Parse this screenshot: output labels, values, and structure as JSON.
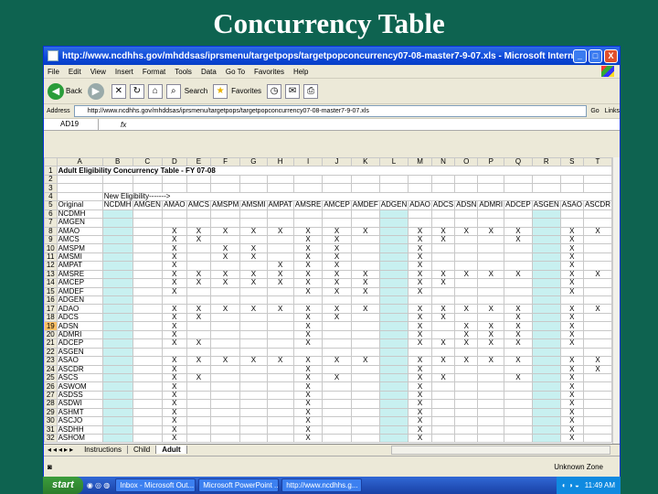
{
  "slide": {
    "title": "Concurrency Table"
  },
  "window": {
    "title": "http://www.ncdhhs.gov/mhddsas/iprsmenu/targetpops/targetpopconcurrency07-08-master7-9-07.xls - Microsoft Internet Explorer",
    "controls": {
      "min": "_",
      "max": "□",
      "close": "X"
    }
  },
  "menu": [
    "File",
    "Edit",
    "View",
    "Insert",
    "Format",
    "Tools",
    "Data",
    "Go To",
    "Favorites",
    "Help"
  ],
  "toolbar": {
    "back": "Back",
    "search": "Search",
    "favorites": "Favorites"
  },
  "address": {
    "label": "Address",
    "url": "http://www.ncdhhs.gov/mhddsas/iprsmenu/targetpops/targetpopconcurrency07-08-master7-9-07.xls",
    "go": "Go",
    "links": "Links"
  },
  "formula": {
    "namebox": "AD19",
    "fx": "fx"
  },
  "sheet": {
    "columns": [
      "A",
      "B",
      "C",
      "D",
      "E",
      "F",
      "G",
      "H",
      "I",
      "J",
      "K",
      "L",
      "M",
      "N",
      "O",
      "P",
      "Q",
      "R",
      "S",
      "T"
    ],
    "title_cell": "Adult Eligibility Concurrency Table - FY 07-08",
    "new_eligibility": "New Eligibility------->",
    "header_row": [
      "Original",
      "NCDMH",
      "AMGEN",
      "AMAO",
      "AMCS",
      "AMSPM",
      "AMSMI",
      "AMPAT",
      "AMSRE",
      "AMCEP",
      "AMDEF",
      "ADGEN",
      "ADAO",
      "ADCS",
      "ADSN",
      "ADMRI",
      "ADCEP",
      "ASGEN",
      "ASAO",
      "ASCDR"
    ],
    "rows": [
      [
        "NCDMH",
        "",
        "",
        "",
        "",
        "",
        "",
        "",
        "",
        "",
        "",
        "",
        "",
        "",
        "",
        "",
        "",
        "",
        "",
        ""
      ],
      [
        "AMGEN",
        "",
        "",
        "",
        "",
        "",
        "",
        "",
        "",
        "",
        "",
        "",
        "",
        "",
        "",
        "",
        "",
        "",
        "",
        ""
      ],
      [
        "AMAO",
        "",
        "",
        "X",
        "X",
        "X",
        "X",
        "X",
        "X",
        "X",
        "X",
        "",
        "X",
        "X",
        "X",
        "X",
        "X",
        "",
        "X",
        "X"
      ],
      [
        "AMCS",
        "",
        "",
        "X",
        "X",
        "",
        "",
        "",
        "X",
        "X",
        "",
        "",
        "X",
        "X",
        "",
        "",
        "X",
        "",
        "X",
        ""
      ],
      [
        "AMSPM",
        "",
        "",
        "X",
        "",
        "X",
        "X",
        "",
        "X",
        "X",
        "",
        "",
        "X",
        "",
        "",
        "",
        "",
        "",
        "X",
        ""
      ],
      [
        "AMSMI",
        "",
        "",
        "X",
        "",
        "X",
        "X",
        "",
        "X",
        "X",
        "",
        "",
        "X",
        "",
        "",
        "",
        "",
        "",
        "X",
        ""
      ],
      [
        "AMPAT",
        "",
        "",
        "X",
        "",
        "",
        "",
        "X",
        "X",
        "X",
        "",
        "",
        "X",
        "",
        "",
        "",
        "",
        "",
        "X",
        ""
      ],
      [
        "AMSRE",
        "",
        "",
        "X",
        "X",
        "X",
        "X",
        "X",
        "X",
        "X",
        "X",
        "",
        "X",
        "X",
        "X",
        "X",
        "X",
        "",
        "X",
        "X"
      ],
      [
        "AMCEP",
        "",
        "",
        "X",
        "X",
        "X",
        "X",
        "X",
        "X",
        "X",
        "X",
        "",
        "X",
        "X",
        "",
        "",
        "",
        "",
        "X",
        ""
      ],
      [
        "AMDEF",
        "",
        "",
        "X",
        "",
        "",
        "",
        "",
        "X",
        "X",
        "X",
        "",
        "X",
        "",
        "",
        "",
        "",
        "",
        "X",
        ""
      ],
      [
        "ADGEN",
        "",
        "",
        "",
        "",
        "",
        "",
        "",
        "",
        "",
        "",
        "",
        "",
        "",
        "",
        "",
        "",
        "",
        "",
        ""
      ],
      [
        "ADAO",
        "",
        "",
        "X",
        "X",
        "X",
        "X",
        "X",
        "X",
        "X",
        "X",
        "",
        "X",
        "X",
        "X",
        "X",
        "X",
        "",
        "X",
        "X"
      ],
      [
        "ADCS",
        "",
        "",
        "X",
        "X",
        "",
        "",
        "",
        "X",
        "X",
        "",
        "",
        "X",
        "X",
        "",
        "",
        "X",
        "",
        "X",
        ""
      ],
      [
        "ADSN",
        "",
        "",
        "X",
        "",
        "",
        "",
        "",
        "X",
        "",
        "",
        "",
        "X",
        "",
        "X",
        "X",
        "X",
        "",
        "X",
        ""
      ],
      [
        "ADMRI",
        "",
        "",
        "X",
        "",
        "",
        "",
        "",
        "X",
        "",
        "",
        "",
        "X",
        "",
        "X",
        "X",
        "X",
        "",
        "X",
        ""
      ],
      [
        "ADCEP",
        "",
        "",
        "X",
        "X",
        "",
        "",
        "",
        "X",
        "",
        "",
        "",
        "X",
        "X",
        "X",
        "X",
        "X",
        "",
        "X",
        ""
      ],
      [
        "ASGEN",
        "",
        "",
        "",
        "",
        "",
        "",
        "",
        "",
        "",
        "",
        "",
        "",
        "",
        "",
        "",
        "",
        "",
        "",
        ""
      ],
      [
        "ASAO",
        "",
        "",
        "X",
        "X",
        "X",
        "X",
        "X",
        "X",
        "X",
        "X",
        "",
        "X",
        "X",
        "X",
        "X",
        "X",
        "",
        "X",
        "X"
      ],
      [
        "ASCDR",
        "",
        "",
        "X",
        "",
        "",
        "",
        "",
        "X",
        "",
        "",
        "",
        "X",
        "",
        "",
        "",
        "",
        "",
        "X",
        "X"
      ],
      [
        "ASCS",
        "",
        "",
        "X",
        "X",
        "",
        "",
        "",
        "X",
        "X",
        "",
        "",
        "X",
        "X",
        "",
        "",
        "X",
        "",
        "X",
        ""
      ],
      [
        "ASWOM",
        "",
        "",
        "X",
        "",
        "",
        "",
        "",
        "X",
        "",
        "",
        "",
        "X",
        "",
        "",
        "",
        "",
        "",
        "X",
        ""
      ],
      [
        "ASDSS",
        "",
        "",
        "X",
        "",
        "",
        "",
        "",
        "X",
        "",
        "",
        "",
        "X",
        "",
        "",
        "",
        "",
        "",
        "X",
        ""
      ],
      [
        "ASDWI",
        "",
        "",
        "X",
        "",
        "",
        "",
        "",
        "X",
        "",
        "",
        "",
        "X",
        "",
        "",
        "",
        "",
        "",
        "X",
        ""
      ],
      [
        "ASHMT",
        "",
        "",
        "X",
        "",
        "",
        "",
        "",
        "X",
        "",
        "",
        "",
        "X",
        "",
        "",
        "",
        "",
        "",
        "X",
        ""
      ],
      [
        "ASCJO",
        "",
        "",
        "X",
        "",
        "",
        "",
        "",
        "X",
        "",
        "",
        "",
        "X",
        "",
        "",
        "",
        "",
        "",
        "X",
        ""
      ],
      [
        "ASDHH",
        "",
        "",
        "X",
        "",
        "",
        "",
        "",
        "X",
        "",
        "",
        "",
        "X",
        "",
        "",
        "",
        "",
        "",
        "X",
        ""
      ],
      [
        "ASHOM",
        "",
        "",
        "X",
        "",
        "",
        "",
        "",
        "X",
        "",
        "",
        "",
        "X",
        "",
        "",
        "",
        "",
        "",
        "X",
        ""
      ]
    ],
    "selected_row": 19
  },
  "sheet_tabs": [
    "Instructions",
    "Child",
    "Adult"
  ],
  "active_tab": "Adult",
  "status": {
    "zone": "Unknown Zone"
  },
  "taskbar": {
    "start": "start",
    "tasks": [
      "Inbox - Microsoft Out...",
      "Microsoft PowerPoint ...",
      "http://www.ncdhhs.g..."
    ],
    "clock": "11:49 AM"
  },
  "colors": {
    "slide_bg": "#0e6350",
    "teal_column": "#c8f0f0",
    "selected_row_header": "#fdc166"
  }
}
